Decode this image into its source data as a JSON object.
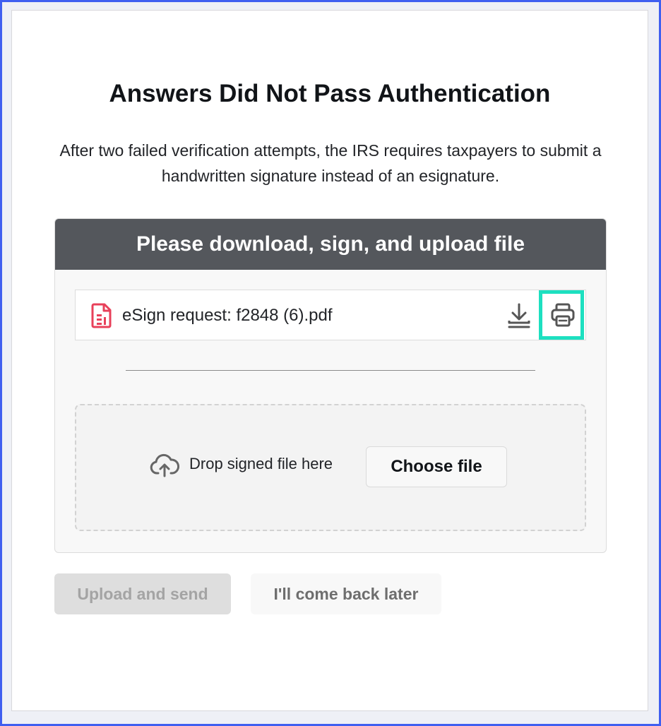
{
  "page": {
    "title": "Answers Did Not Pass Authentication",
    "subtitle": "After two failed verification attempts, the IRS requires taxpayers to submit a handwritten signature instead of an esignature."
  },
  "panel": {
    "header": "Please download, sign, and upload file",
    "file": {
      "name": "eSign request: f2848 (6).pdf",
      "icon": "pdf-file-icon",
      "actions": [
        "download-icon",
        "print-icon"
      ]
    },
    "dropzone": {
      "text": "Drop signed file here",
      "icon": "cloud-upload-icon",
      "choose_label": "Choose file"
    }
  },
  "actions": {
    "upload_label": "Upload and send",
    "later_label": "I'll come back later"
  },
  "colors": {
    "accent_highlight": "#1de0c0",
    "header_bg": "#54575c",
    "file_icon": "#e8405a",
    "frame_border": "#3f5ff0"
  }
}
